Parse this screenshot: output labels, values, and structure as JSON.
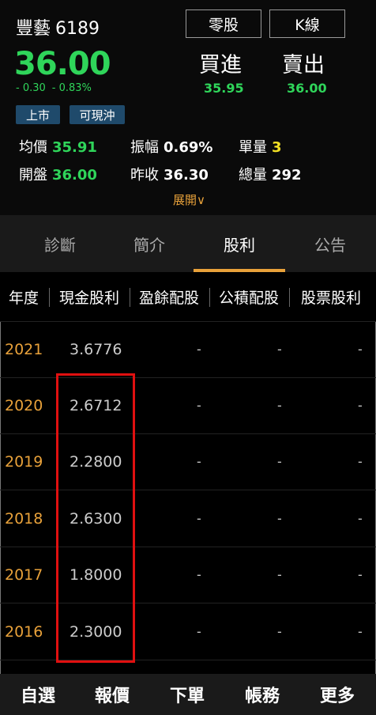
{
  "stock": {
    "name": "豐藝",
    "code": "6189",
    "price": "36.00",
    "change": "- 0.30",
    "change_pct": "- 0.83%",
    "tags": [
      "上市",
      "可現沖"
    ]
  },
  "buttons": {
    "odd_lot": "零股",
    "kline": "K線"
  },
  "trade": {
    "buy_label": "買進",
    "buy_value": "35.95",
    "sell_label": "賣出",
    "sell_value": "36.00"
  },
  "stats": {
    "avg_label": "均價",
    "avg_value": "35.91",
    "amp_label": "振幅",
    "amp_value": "0.69%",
    "unit_label": "單量",
    "unit_value": "3",
    "open_label": "開盤",
    "open_value": "36.00",
    "prev_label": "昨收",
    "prev_value": "36.30",
    "vol_label": "總量",
    "vol_value": "292"
  },
  "expand_label": "展開∨",
  "tabs": [
    "診斷",
    "簡介",
    "股利",
    "公告"
  ],
  "active_tab": "股利",
  "table": {
    "headers": [
      "年度",
      "現金股利",
      "盈餘配股",
      "公積配股",
      "股票股利"
    ],
    "rows": [
      {
        "year": "2021",
        "cash": "3.6776",
        "earnings": "-",
        "capital": "-",
        "stock": "-"
      },
      {
        "year": "2020",
        "cash": "2.6712",
        "earnings": "-",
        "capital": "-",
        "stock": "-"
      },
      {
        "year": "2019",
        "cash": "2.2800",
        "earnings": "-",
        "capital": "-",
        "stock": "-"
      },
      {
        "year": "2018",
        "cash": "2.6300",
        "earnings": "-",
        "capital": "-",
        "stock": "-"
      },
      {
        "year": "2017",
        "cash": "1.8000",
        "earnings": "-",
        "capital": "-",
        "stock": "-"
      },
      {
        "year": "2016",
        "cash": "2.3000",
        "earnings": "-",
        "capital": "-",
        "stock": "-"
      }
    ]
  },
  "bottom_nav": [
    "自選",
    "報價",
    "下單",
    "帳務",
    "更多"
  ],
  "colors": {
    "up_green": "#2fd55a",
    "accent_orange": "#e8a13a",
    "tag_blue": "#1f4a6b",
    "highlight_red": "#e01010"
  }
}
